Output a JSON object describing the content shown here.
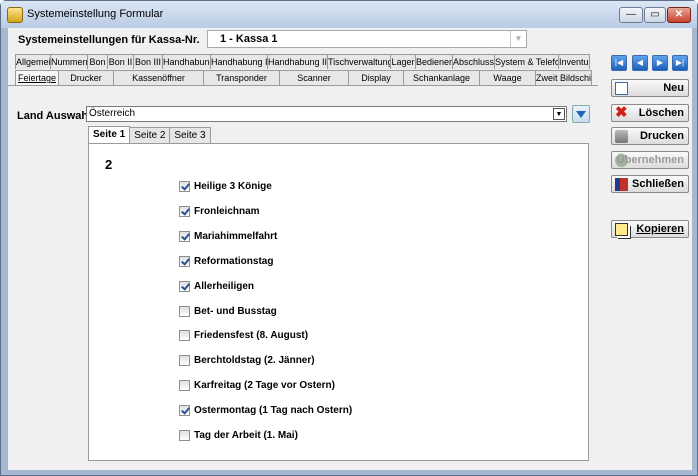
{
  "window": {
    "title": "Systemeinstellung Formular",
    "controls": {
      "minimize": "—",
      "maximize": "▭",
      "close": "✕"
    }
  },
  "kassa": {
    "label": "Systemeinstellungen für Kassa-Nr.",
    "selected": "1 - Kassa 1",
    "arrow": "▼"
  },
  "tabs_row1": [
    "Allgemein",
    "Nummern",
    "Bon",
    "Bon II",
    "Bon III",
    "Handhabung",
    "Handhabung II",
    "Handhabung III",
    "Tischverwaltung",
    "Lager",
    "Bediener",
    "Abschluss",
    "System & Telefon",
    "Inventur"
  ],
  "tabs_row2": [
    "Feiertage",
    "Drucker",
    "Kassenöffner",
    "Transponder",
    "Scanner",
    "Display",
    "Schankanlage",
    "Waage",
    "Zweit Bildschirm"
  ],
  "active_tab": "Feiertage",
  "land": {
    "label": "Land Auswahl",
    "selected": "Österreich",
    "arrow": "▼"
  },
  "subtabs": [
    "Seite 1",
    "Seite 2",
    "Seite 3"
  ],
  "active_subtab": "Seite 1",
  "page_number": "2",
  "holidays": [
    {
      "label": "Heilige 3 Könige",
      "checked": true
    },
    {
      "label": "Fronleichnam",
      "checked": true
    },
    {
      "label": "Mariahimmelfahrt",
      "checked": true
    },
    {
      "label": "Reformationstag",
      "checked": true
    },
    {
      "label": "Allerheiligen",
      "checked": true
    },
    {
      "label": "Bet- und Busstag",
      "checked": false
    },
    {
      "label": "Friedensfest (8. August)",
      "checked": false
    },
    {
      "label": "Berchtoldstag (2. Jänner)",
      "checked": false
    },
    {
      "label": "Karfreitag (2 Tage vor Ostern)",
      "checked": false
    },
    {
      "label": "Ostermontag (1 Tag nach Ostern)",
      "checked": true
    },
    {
      "label": "Tag der Arbeit (1. Mai)",
      "checked": false
    }
  ],
  "nav": {
    "first": "|◀",
    "prev": "◀",
    "next": "▶",
    "last": "▶|"
  },
  "buttons": {
    "neu": "Neu",
    "loeschen": "Löschen",
    "drucken": "Drucken",
    "uebernehmen": "Übernehmen",
    "schliessen": "Schließen",
    "kopieren": "Kopieren"
  }
}
